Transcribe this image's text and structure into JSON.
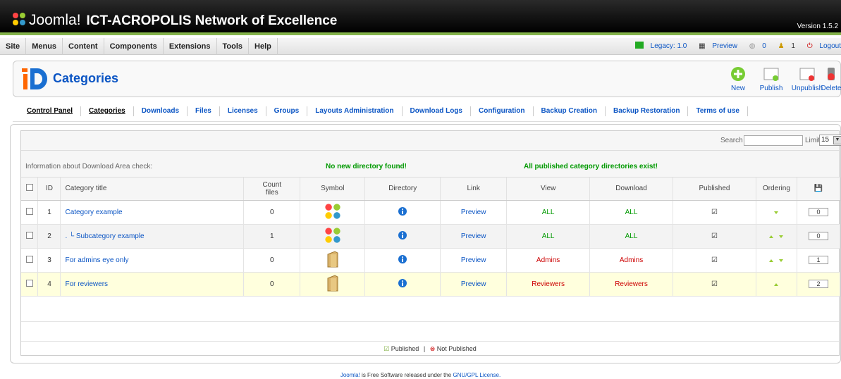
{
  "header": {
    "brand": "Joomla!",
    "site_name": "ICT-ACROPOLIS Network of Excellence",
    "version": "Version 1.5.2"
  },
  "menu": [
    "Site",
    "Menus",
    "Content",
    "Components",
    "Extensions",
    "Tools",
    "Help"
  ],
  "status": {
    "legacy": "Legacy: 1.0",
    "preview": "Preview",
    "messages": "0",
    "users": "1",
    "logout": "Logout"
  },
  "page": {
    "title": "Categories"
  },
  "toolbar": {
    "new": "New",
    "publish": "Publish",
    "unpublish": "Unpublish",
    "delete": "Delete"
  },
  "submenu": [
    "Control Panel",
    "Categories",
    "Downloads",
    "Files",
    "Licenses",
    "Groups",
    "Layouts Administration",
    "Download Logs",
    "Configuration",
    "Backup Creation",
    "Backup Restoration",
    "Terms of use"
  ],
  "filter": {
    "search_label": "Search",
    "limit_label": "Limit",
    "limit_value": "15"
  },
  "info": {
    "label": "Information about Download Area check:",
    "dir_msg": "No new directory found!",
    "pub_msg": "All published category directories exist!"
  },
  "columns": {
    "id": "ID",
    "title": "Category title",
    "count": "Count files",
    "symbol": "Symbol",
    "directory": "Directory",
    "link": "Link",
    "view": "View",
    "download": "Download",
    "published": "Published",
    "ordering": "Ordering"
  },
  "rows": [
    {
      "id": "1",
      "title": "Category example",
      "count": "0",
      "link": "Preview",
      "view": "ALL",
      "download": "ALL",
      "order": "0"
    },
    {
      "id": "2",
      "title": ". └  Subcategory example",
      "count": "1",
      "link": "Preview",
      "view": "ALL",
      "download": "ALL",
      "order": "0"
    },
    {
      "id": "3",
      "title": "For admins eye only",
      "count": "0",
      "link": "Preview",
      "view": "Admins",
      "download": "Admins",
      "order": "1"
    },
    {
      "id": "4",
      "title": "For reviewers",
      "count": "0",
      "link": "Preview",
      "view": "Reviewers",
      "download": "Reviewers",
      "order": "2"
    }
  ],
  "legend": {
    "published": "Published",
    "sep": "|",
    "not_published": "Not Published"
  },
  "footer": {
    "joomla": "Joomla!",
    "text": " is Free Software released under the ",
    "license": "GNU/GPL License."
  }
}
